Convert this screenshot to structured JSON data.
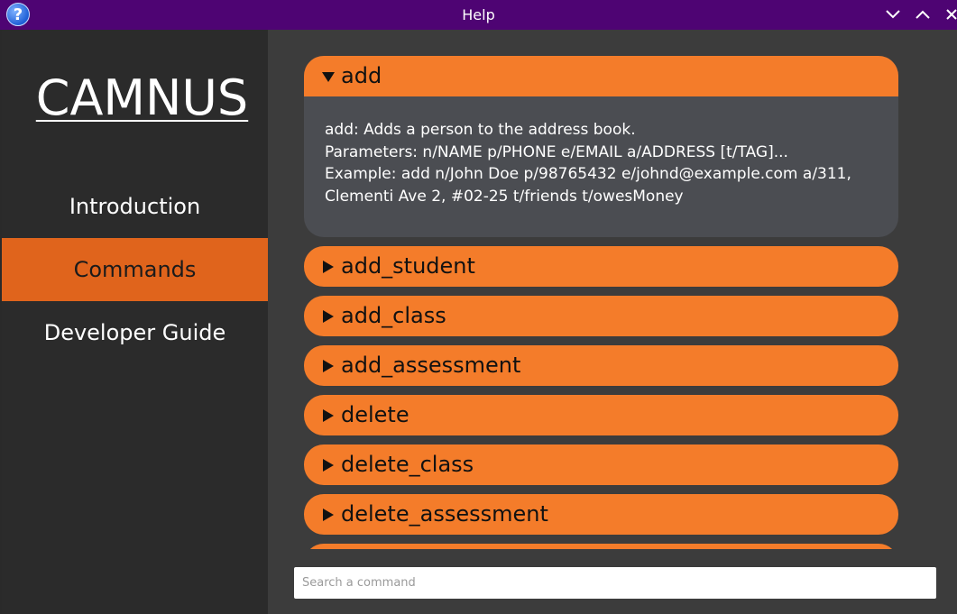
{
  "window": {
    "title": "Help",
    "icon": "help-question-icon",
    "controls": [
      "minimize-icon",
      "maximize-icon",
      "close-icon"
    ]
  },
  "sidebar": {
    "logo": "CAMNUS",
    "items": [
      {
        "label": "Introduction",
        "active": false
      },
      {
        "label": "Commands",
        "active": true
      },
      {
        "label": "Developer Guide",
        "active": false
      }
    ]
  },
  "commands": {
    "expanded": {
      "name": "add",
      "description": [
        "add: Adds a person to the address book.",
        "Parameters: n/NAME p/PHONE e/EMAIL a/ADDRESS [t/TAG]...",
        "Example: add n/John Doe p/98765432 e/johnd@example.com a/311,",
        "Clementi Ave 2, #02-25 t/friends t/owesMoney"
      ]
    },
    "collapsed": [
      "add_student",
      "add_class",
      "add_assessment",
      "delete",
      "delete_class",
      "delete_assessment"
    ]
  },
  "search": {
    "placeholder": "Search a command",
    "value": ""
  },
  "colors": {
    "titlebar": "#4e0473",
    "accent": "#f47c2a",
    "active_nav": "#e0641c",
    "sidebar": "#2b2b2b",
    "main": "#3c3c3c",
    "expanded_body": "#4b4d52"
  }
}
